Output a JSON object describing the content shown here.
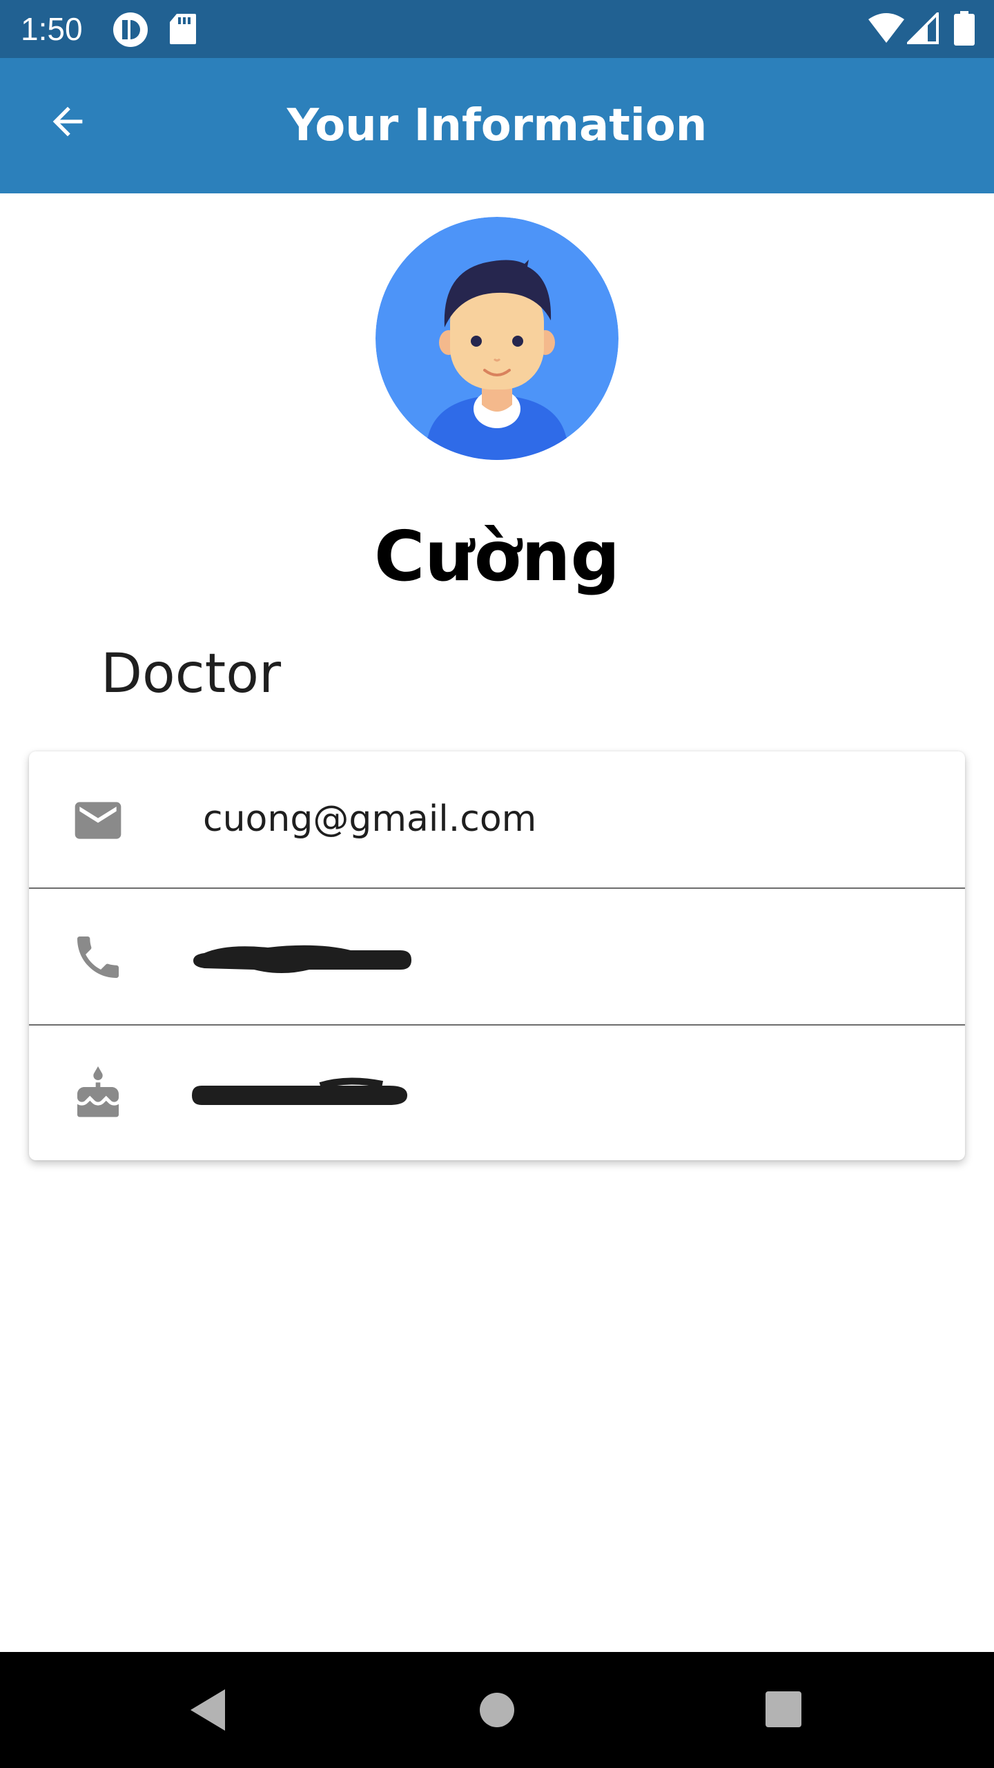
{
  "status_bar": {
    "time": "1:50",
    "icons": [
      "notification-app-icon",
      "sd-card-icon",
      "wifi-icon",
      "cell-signal-icon",
      "battery-icon"
    ]
  },
  "app_bar": {
    "title": "Your Information",
    "back_icon": "arrow-back-icon"
  },
  "profile": {
    "name": "Cường",
    "role": "Doctor",
    "avatar_icon": "user-avatar-illustration"
  },
  "details": {
    "email": {
      "icon": "mail-icon",
      "value": "cuong@gmail.com"
    },
    "phone": {
      "icon": "phone-icon",
      "value": ""
    },
    "birthday": {
      "icon": "cake-icon",
      "value": ""
    }
  },
  "nav_bar": {
    "icons": [
      "back-triangle-icon",
      "home-circle-icon",
      "recents-square-icon"
    ]
  },
  "colors": {
    "status_bar": "#216192",
    "app_bar": "#2c80bb",
    "avatar_bg": "#4d94f8",
    "icon_gray": "#8a8a8a"
  }
}
